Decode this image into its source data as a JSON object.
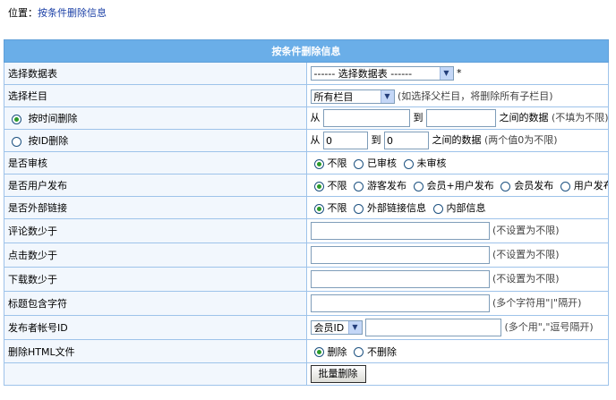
{
  "location": {
    "prefix": "位置：",
    "link": "按条件删除信息"
  },
  "form": {
    "title": "按条件删除信息",
    "table_select": {
      "label": "选择数据表",
      "value": "------ 选择数据表 ------",
      "required_mark": "*"
    },
    "column_select": {
      "label": "选择栏目",
      "value": "所有栏目",
      "hint": "(如选择父栏目，将删除所有子栏目)"
    },
    "by_time": {
      "label": "按时间删除",
      "from": "从",
      "to": "到",
      "between": "之间的数据",
      "hint": "(不填为不限)"
    },
    "by_id": {
      "label": "按ID删除",
      "from": "从",
      "from_value": "0",
      "to": "到",
      "to_value": "0",
      "between": "之间的数据",
      "hint": "(两个值0为不限)"
    },
    "audit": {
      "label": "是否审核",
      "options": [
        "不限",
        "已审核",
        "未审核"
      ]
    },
    "publisher": {
      "label": "是否用户发布",
      "options": [
        "不限",
        "游客发布",
        "会员+用户发布",
        "会员发布",
        "用户发布"
      ]
    },
    "external": {
      "label": "是否外部链接",
      "options": [
        "不限",
        "外部链接信息",
        "内部信息"
      ]
    },
    "comments": {
      "label": "评论数少于",
      "hint": "(不设置为不限)"
    },
    "clicks": {
      "label": "点击数少于",
      "hint": "(不设置为不限)"
    },
    "downloads": {
      "label": "下载数少于",
      "hint": "(不设置为不限)"
    },
    "title_contains": {
      "label": "标题包含字符",
      "hint": "(多个字符用\"|\"隔开)"
    },
    "author_id": {
      "label": "发布者帐号ID",
      "type_value": "会员ID",
      "hint": "(多个用\",\"逗号隔开)"
    },
    "delete_html": {
      "label": "删除HTML文件",
      "options": [
        "删除",
        "不删除"
      ]
    },
    "submit_label": "批量删除"
  }
}
